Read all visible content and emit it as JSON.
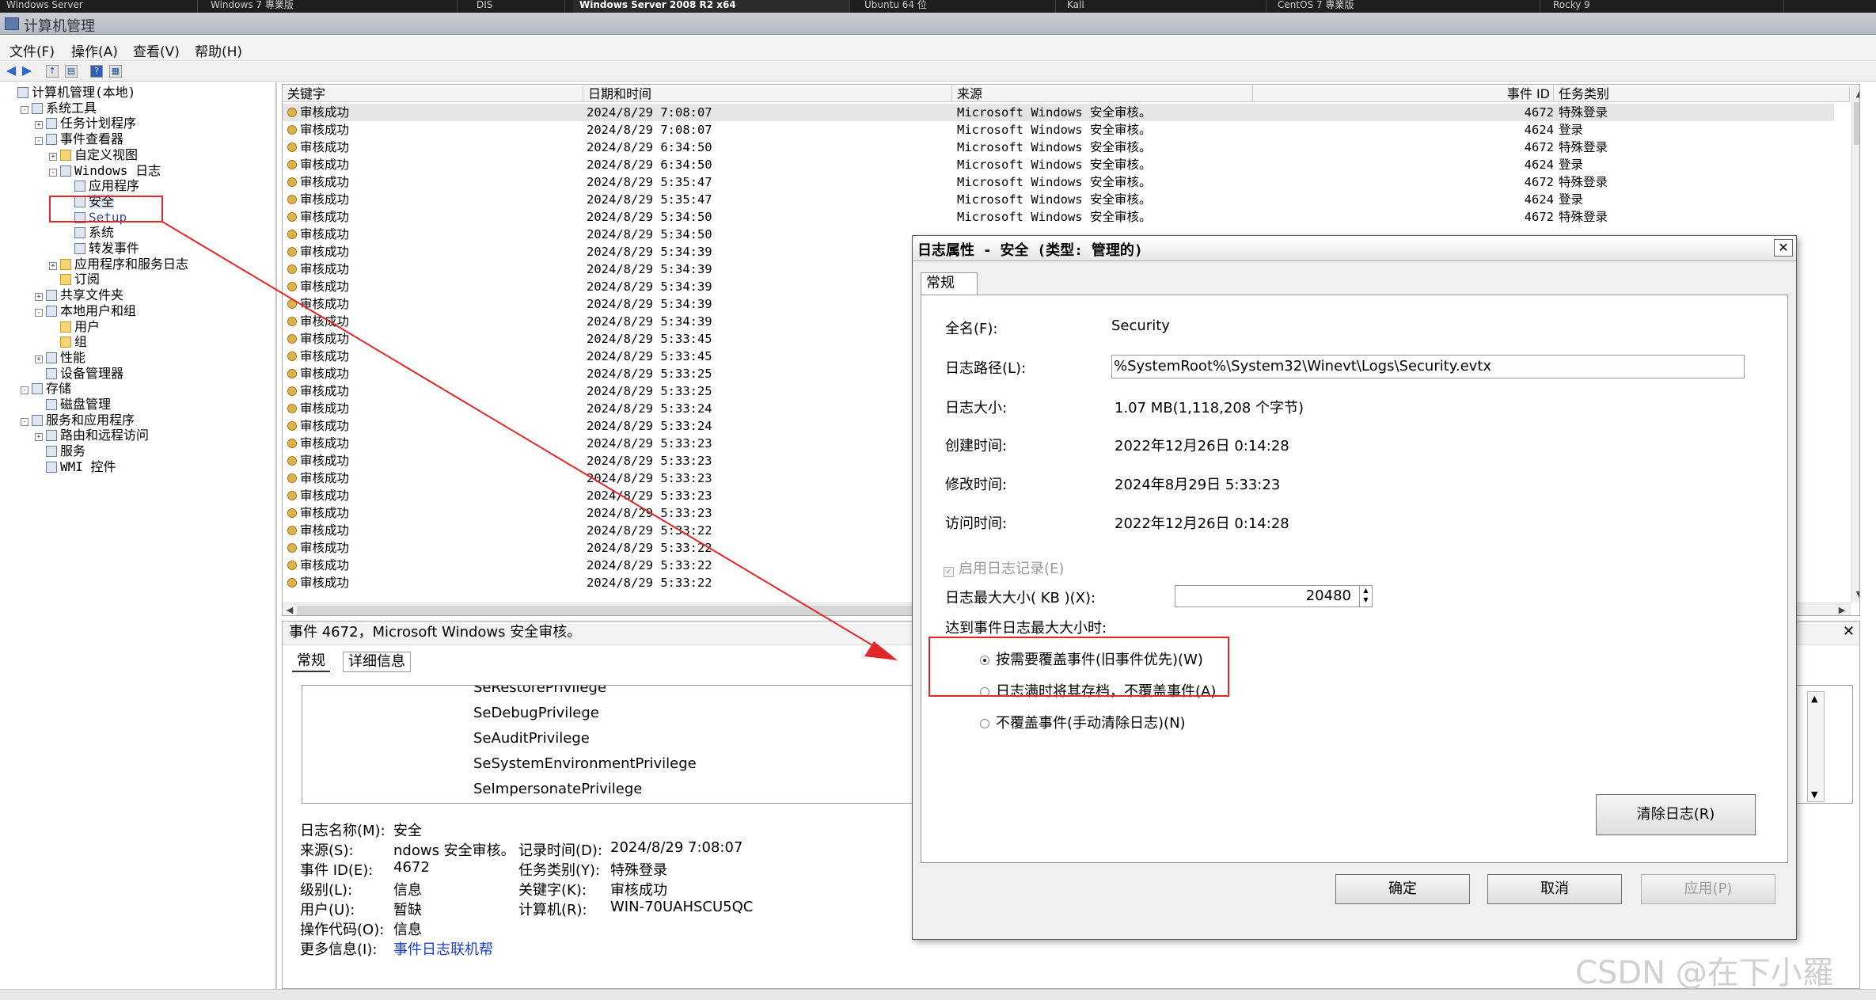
{
  "browser_tabs": [
    "Windows Server",
    "Windows 7 專業版",
    "DIS",
    "Windows Server 2008 R2 x64",
    "Ubuntu 64 位",
    "Kali",
    "CentOS 7 專業版",
    "Rocky 9"
  ],
  "window": {
    "title": "计算机管理"
  },
  "menu": [
    "文件(F)",
    "操作(A)",
    "查看(V)",
    "帮助(H)"
  ],
  "toolbar": [
    "back-icon",
    "forward-icon",
    "up-icon",
    "properties-icon",
    "help-icon",
    "view-icon"
  ],
  "tree": [
    {
      "label": "计算机管理(本地)",
      "level": 0,
      "expander": ""
    },
    {
      "label": "系统工具",
      "level": 1,
      "expander": "-"
    },
    {
      "label": "任务计划程序",
      "level": 2,
      "expander": "+"
    },
    {
      "label": "事件查看器",
      "level": 2,
      "expander": "-"
    },
    {
      "label": "自定义视图",
      "level": 3,
      "expander": "+"
    },
    {
      "label": "Windows 日志",
      "level": 3,
      "expander": "-"
    },
    {
      "label": "应用程序",
      "level": 4,
      "expander": ""
    },
    {
      "label": "安全",
      "level": 4,
      "expander": "",
      "selected": true
    },
    {
      "label": "Setup",
      "level": 4,
      "expander": "",
      "blue": true
    },
    {
      "label": "系统",
      "level": 4,
      "expander": ""
    },
    {
      "label": "转发事件",
      "level": 4,
      "expander": ""
    },
    {
      "label": "应用程序和服务日志",
      "level": 3,
      "expander": "+"
    },
    {
      "label": "订阅",
      "level": 3,
      "expander": ""
    },
    {
      "label": "共享文件夹",
      "level": 2,
      "expander": "+"
    },
    {
      "label": "本地用户和组",
      "level": 2,
      "expander": "-"
    },
    {
      "label": "用户",
      "level": 3,
      "expander": ""
    },
    {
      "label": "组",
      "level": 3,
      "expander": ""
    },
    {
      "label": "性能",
      "level": 2,
      "expander": "+"
    },
    {
      "label": "设备管理器",
      "level": 2,
      "expander": ""
    },
    {
      "label": "存储",
      "level": 1,
      "expander": "-"
    },
    {
      "label": "磁盘管理",
      "level": 2,
      "expander": ""
    },
    {
      "label": "服务和应用程序",
      "level": 1,
      "expander": "-"
    },
    {
      "label": "路由和远程访问",
      "level": 2,
      "expander": "+"
    },
    {
      "label": "服务",
      "level": 2,
      "expander": ""
    },
    {
      "label": "WMI 控件",
      "level": 2,
      "expander": ""
    }
  ],
  "list": {
    "columns": [
      "关键字",
      "日期和时间",
      "来源",
      "事件 ID",
      "任务类别"
    ],
    "rows": [
      [
        "审核成功",
        "2024/8/29 7:08:07",
        "Microsoft Windows 安全审核。",
        "4672",
        "特殊登录"
      ],
      [
        "审核成功",
        "2024/8/29 7:08:07",
        "Microsoft Windows 安全审核。",
        "4624",
        "登录"
      ],
      [
        "审核成功",
        "2024/8/29 6:34:50",
        "Microsoft Windows 安全审核。",
        "4672",
        "特殊登录"
      ],
      [
        "审核成功",
        "2024/8/29 6:34:50",
        "Microsoft Windows 安全审核。",
        "4624",
        "登录"
      ],
      [
        "审核成功",
        "2024/8/29 5:35:47",
        "Microsoft Windows 安全审核。",
        "4672",
        "特殊登录"
      ],
      [
        "审核成功",
        "2024/8/29 5:35:47",
        "Microsoft Windows 安全审核。",
        "4624",
        "登录"
      ],
      [
        "审核成功",
        "2024/8/29 5:34:50",
        "Microsoft Windows 安全审核。",
        "4672",
        "特殊登录"
      ],
      [
        "审核成功",
        "2024/8/29 5:34:50",
        "",
        "",
        ""
      ],
      [
        "审核成功",
        "2024/8/29 5:34:39",
        "",
        "",
        ""
      ],
      [
        "审核成功",
        "2024/8/29 5:34:39",
        "",
        "",
        ""
      ],
      [
        "审核成功",
        "2024/8/29 5:34:39",
        "",
        "",
        ""
      ],
      [
        "审核成功",
        "2024/8/29 5:34:39",
        "",
        "",
        ""
      ],
      [
        "审核成功",
        "2024/8/29 5:34:39",
        "",
        "",
        ""
      ],
      [
        "审核成功",
        "2024/8/29 5:33:45",
        "",
        "",
        ""
      ],
      [
        "审核成功",
        "2024/8/29 5:33:45",
        "",
        "",
        ""
      ],
      [
        "审核成功",
        "2024/8/29 5:33:25",
        "",
        "",
        ""
      ],
      [
        "审核成功",
        "2024/8/29 5:33:25",
        "",
        "",
        ""
      ],
      [
        "审核成功",
        "2024/8/29 5:33:24",
        "",
        "",
        ""
      ],
      [
        "审核成功",
        "2024/8/29 5:33:24",
        "",
        "",
        ""
      ],
      [
        "审核成功",
        "2024/8/29 5:33:23",
        "",
        "",
        ""
      ],
      [
        "审核成功",
        "2024/8/29 5:33:23",
        "",
        "",
        ""
      ],
      [
        "审核成功",
        "2024/8/29 5:33:23",
        "",
        "",
        ""
      ],
      [
        "审核成功",
        "2024/8/29 5:33:23",
        "",
        "",
        ""
      ],
      [
        "审核成功",
        "2024/8/29 5:33:23",
        "",
        "",
        ""
      ],
      [
        "审核成功",
        "2024/8/29 5:33:22",
        "",
        "",
        ""
      ],
      [
        "审核成功",
        "2024/8/29 5:33:22",
        "",
        "",
        ""
      ],
      [
        "审核成功",
        "2024/8/29 5:33:22",
        "",
        "",
        ""
      ],
      [
        "审核成功",
        "2024/8/29 5:33:22",
        "",
        "",
        ""
      ]
    ]
  },
  "detail": {
    "header": "事件 4672，Microsoft Windows 安全审核。",
    "tabs": [
      "常规",
      "详细信息"
    ],
    "privileges": [
      "SeRestorePrivilege",
      "SeDebugPrivilege",
      "SeAuditPrivilege",
      "SeSystemEnvironmentPrivilege",
      "SeImpersonatePrivilege"
    ],
    "fields_left": [
      {
        "label": "日志名称(M):",
        "value": "安全"
      },
      {
        "label": "来源(S):",
        "value": "ndows 安全审核。"
      },
      {
        "label": "事件 ID(E):",
        "value": "4672"
      },
      {
        "label": "级别(L):",
        "value": "信息"
      },
      {
        "label": "用户(U):",
        "value": "暂缺"
      },
      {
        "label": "操作代码(O):",
        "value": "信息"
      },
      {
        "label": "更多信息(I):",
        "value": "事件日志联机帮"
      }
    ],
    "fields_right": [
      {
        "label": "记录时间(D):",
        "value": "2024/8/29 7:08:07"
      },
      {
        "label": "任务类别(Y):",
        "value": "特殊登录"
      },
      {
        "label": "关键字(K):",
        "value": "审核成功"
      },
      {
        "label": "计算机(R):",
        "value": "WIN-70UAHSCU5QC"
      }
    ]
  },
  "dialog": {
    "title": "日志属性 - 安全 (类型: 管理的)",
    "tab": "常规",
    "fullname_label": "全名(F):",
    "fullname": "Security",
    "path_label": "日志路径(L):",
    "path": "%SystemRoot%\\System32\\Winevt\\Logs\\Security.evtx",
    "size_label": "日志大小:",
    "size": "1.07 MB(1,118,208 个字节)",
    "created_label": "创建时间:",
    "created": "2022年12月26日 0:14:28",
    "modified_label": "修改时间:",
    "modified": "2024年8月29日 5:33:23",
    "accessed_label": "访问时间:",
    "accessed": "2022年12月26日 0:14:28",
    "enable_label": "启用日志记录(E)",
    "maxsize_label": "日志最大大小( KB )(X):",
    "maxsize": "20480",
    "when_full_label": "达到事件日志最大大小时:",
    "opt_overwrite": "按需要覆盖事件(旧事件优先)(W)",
    "opt_archive": "日志满时将其存档，不覆盖事件(A)",
    "opt_manual": "不覆盖事件(手动清除日志)(N)",
    "clear_button": "清除日志(R)",
    "ok": "确定",
    "cancel": "取消",
    "apply": "应用(P)",
    "close": "✕"
  },
  "watermark": "CSDN @在下小羅",
  "annotation_color": "#e0282a"
}
